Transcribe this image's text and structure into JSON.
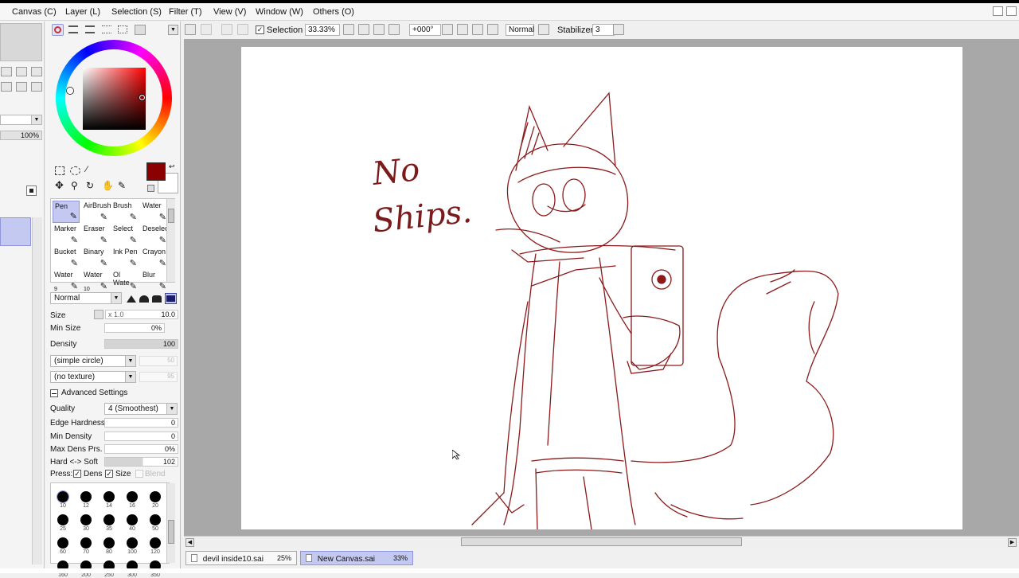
{
  "menu": [
    "Canvas (C)",
    "Layer (L)",
    "Selection (S)",
    "Filter (T)",
    "View (V)",
    "Window (W)",
    "Others (O)"
  ],
  "toolbar": {
    "selection_label": "Selection",
    "zoom": "33.33%",
    "rotation": "+000°",
    "blend_mode": "Normal",
    "stabilizer_label": "Stabilizer",
    "stabilizer_value": "3"
  },
  "left_strip": {
    "opacity": "100%"
  },
  "tools": [
    {
      "label": "Pen",
      "sub": ""
    },
    {
      "label": "AirBrush",
      "sub": ""
    },
    {
      "label": "Brush",
      "sub": ""
    },
    {
      "label": "Water",
      "sub": ""
    },
    {
      "label": "Marker",
      "sub": ""
    },
    {
      "label": "Eraser",
      "sub": ""
    },
    {
      "label": "Select",
      "sub": ""
    },
    {
      "label": "Deselect",
      "sub": ""
    },
    {
      "label": "Bucket",
      "sub": ""
    },
    {
      "label": "Binary",
      "sub": ""
    },
    {
      "label": "Ink Pen",
      "sub": ""
    },
    {
      "label": "Crayon",
      "sub": ""
    },
    {
      "label": "Water",
      "sub": "9"
    },
    {
      "label": "Water",
      "sub": "10"
    },
    {
      "label": "Ol Wate",
      "sub": ""
    },
    {
      "label": "Blur",
      "sub": ""
    }
  ],
  "brush": {
    "mode": "Normal",
    "size_label": "Size",
    "size_mult": "x 1.0",
    "size_value": "10.0",
    "min_size_label": "Min Size",
    "min_size_value": "0%",
    "density_label": "Density",
    "density_value": "100",
    "shape": "(simple circle)",
    "shape_value": "50",
    "texture": "(no texture)",
    "texture_value": "95",
    "advanced_label": "Advanced Settings",
    "quality_label": "Quality",
    "quality_value": "4 (Smoothest)",
    "edge_label": "Edge Hardness",
    "edge_value": "0",
    "min_density_label": "Min Density",
    "min_density_value": "0",
    "max_dens_label": "Max Dens Prs.",
    "max_dens_value": "0%",
    "hard_soft_label": "Hard <-> Soft",
    "hard_soft_value": "102",
    "press_label": "Press:",
    "dens_label": "Dens",
    "size_chk_label": "Size",
    "blend_label": "Blend"
  },
  "brush_sizes": [
    "10",
    "12",
    "14",
    "16",
    "20",
    "25",
    "30",
    "35",
    "40",
    "50",
    "60",
    "70",
    "80",
    "100",
    "120",
    "160",
    "200",
    "250",
    "300",
    "350"
  ],
  "colors": {
    "primary": "#8b0000",
    "accent": "#8f97da"
  },
  "canvas_text": {
    "line1": "No",
    "line2": "Ships."
  },
  "files": [
    {
      "name": "devil inside10.sai",
      "zoom": "25%"
    },
    {
      "name": "New Canvas.sai",
      "zoom": "33%"
    }
  ]
}
